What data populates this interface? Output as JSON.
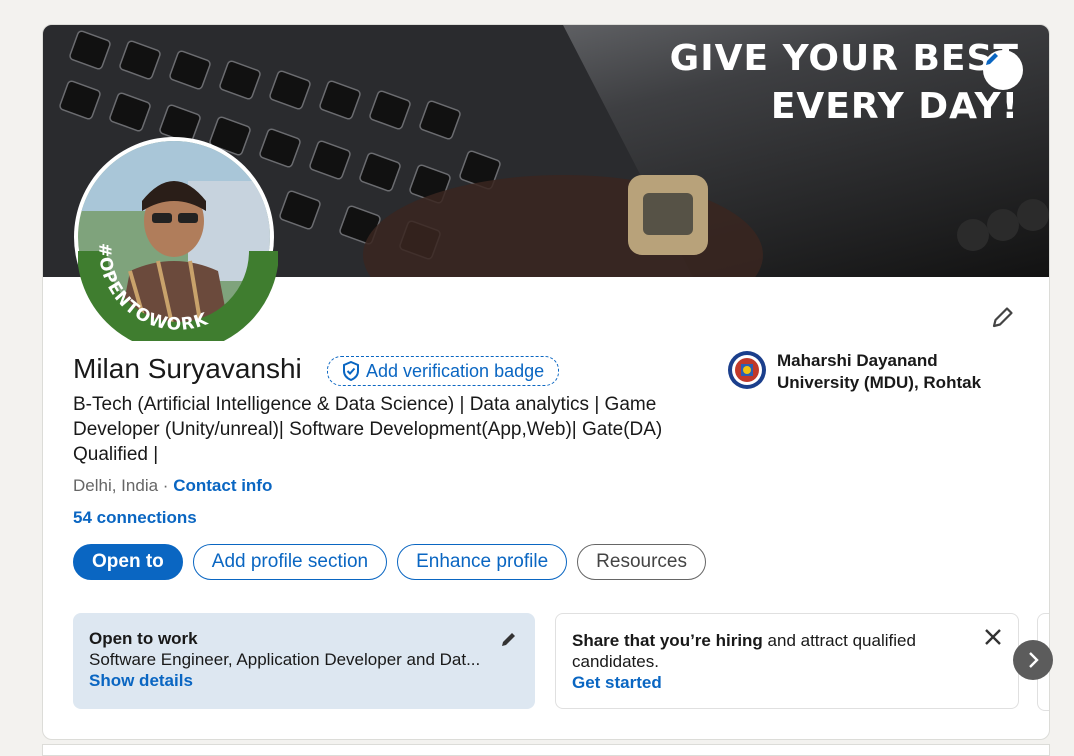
{
  "banner": {
    "text_line1": "GIVE YOUR BEST",
    "text_line2": "EVERY DAY!",
    "edit_icon": "pencil-icon"
  },
  "avatar": {
    "tag": "#OPENTOWORK",
    "frame_color": "#2e7d32"
  },
  "profile": {
    "name": "Milan Suryavanshi",
    "verify_badge_label": "Add verification badge",
    "headline": "B-Tech (Artificial Intelligence & Data Science) | Data analytics | Game Developer (Unity/unreal)| Software Development(App,Web)| Gate(DA) Qualified |",
    "location": "Delhi, India",
    "separator": "·",
    "contact_info": "Contact info",
    "connections": "54 connections"
  },
  "education": {
    "name": "Maharshi Dayanand University (MDU), Rohtak"
  },
  "actions": {
    "open_to": "Open to",
    "add_section": "Add profile section",
    "enhance": "Enhance profile",
    "resources": "Resources"
  },
  "open_to_work": {
    "title": "Open to work",
    "roles": "Software Engineer, Application Developer and Dat...",
    "link": "Show details"
  },
  "hiring": {
    "bold": "Share that you’re hiring",
    "rest": " and attract qualified candidates.",
    "link": "Get started"
  },
  "colors": {
    "accent": "#0a66c2",
    "otw_bg": "#dde7f1"
  }
}
